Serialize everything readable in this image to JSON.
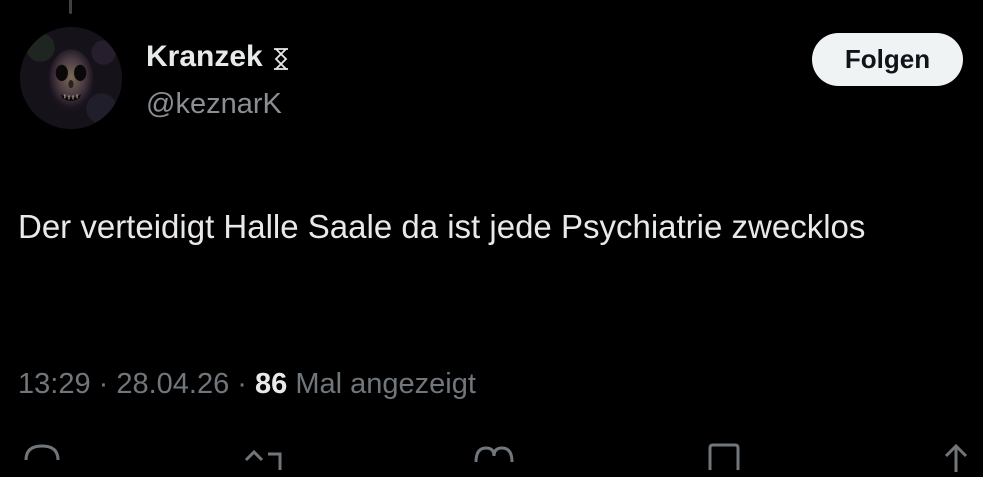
{
  "author": {
    "display_name": "Kranzek",
    "verified_icon": "hourglass-icon",
    "handle": "@keznarK",
    "avatar_icon": "mask-face-avatar"
  },
  "follow_button": {
    "label": "Folgen"
  },
  "tweet": {
    "text": "Der verteidigt Halle Saale da ist jede Psychiatrie zwecklos"
  },
  "meta": {
    "time": "13:29",
    "separator1": " · ",
    "date": "28.04.26",
    "separator2": " · ",
    "views_count": "86",
    "views_label": " Mal angezeigt"
  },
  "actions": [
    {
      "icon": "reply-icon"
    },
    {
      "icon": "retweet-icon"
    },
    {
      "icon": "like-icon"
    },
    {
      "icon": "bookmark-icon"
    },
    {
      "icon": "share-icon"
    }
  ],
  "colors": {
    "background": "#000000",
    "primary_text": "#e7e9ea",
    "secondary_text": "#71767b",
    "button_bg": "#eff3f4",
    "button_text": "#0f1419"
  }
}
